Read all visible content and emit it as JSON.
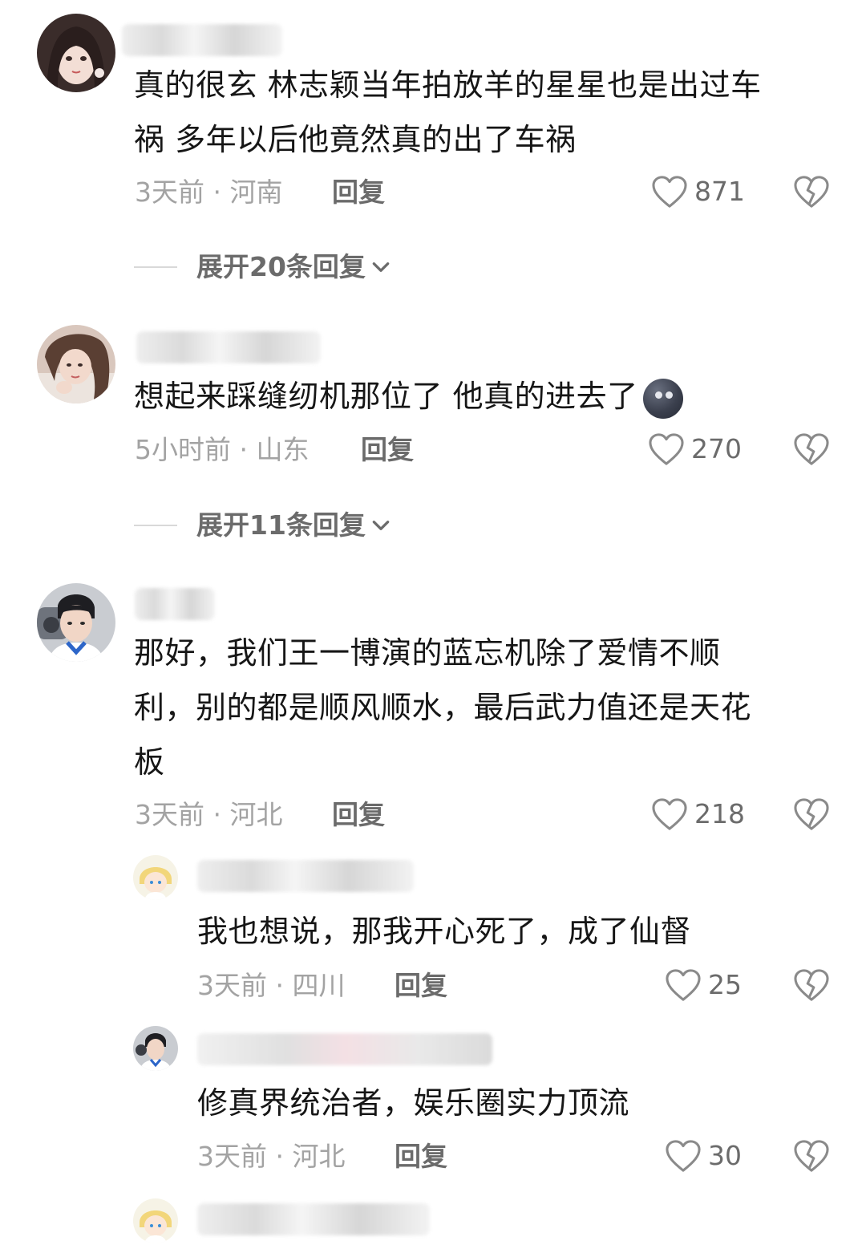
{
  "comments": [
    {
      "avatar_icon": "girl-avatar-icon",
      "text_lines": [
        "真的很玄 林志颖当年拍放羊的星星也是出过车",
        "祸 多年以后他竟然真的出了车祸"
      ],
      "meta": "3天前 · 河南",
      "reply_label": "回复",
      "likes": "871",
      "expand_label": "展开20条回复"
    },
    {
      "avatar_icon": "woman-avatar-icon",
      "text": "想起来踩缝纫机那位了 他真的进去了",
      "emoji": "dark-moon-face-emoji",
      "meta": "5小时前 · 山东",
      "reply_label": "回复",
      "likes": "270",
      "expand_label": "展开11条回复"
    },
    {
      "avatar_icon": "boy-avatar-icon",
      "text_lines": [
        "那好，我们王一博演的蓝忘机除了爱情不顺",
        "利，别的都是顺风顺水，最后武力值还是天花",
        "板"
      ],
      "meta": "3天前 · 河北",
      "reply_label": "回复",
      "likes": "218"
    }
  ],
  "replies": [
    {
      "avatar_icon": "cartoon-avatar-icon",
      "text": "我也想说，那我开心死了，成了仙督",
      "meta": "3天前 · 四川",
      "reply_label": "回复",
      "likes": "25"
    },
    {
      "avatar_icon": "boy-avatar-icon",
      "text": "修真界统治者，娱乐圈实力顶流",
      "meta": "3天前 · 河北",
      "reply_label": "回复",
      "likes": "30"
    }
  ],
  "colors": {
    "text": "#161616",
    "meta": "#a3a3a3",
    "action": "#6b6b6b",
    "background": "#ffffff"
  }
}
